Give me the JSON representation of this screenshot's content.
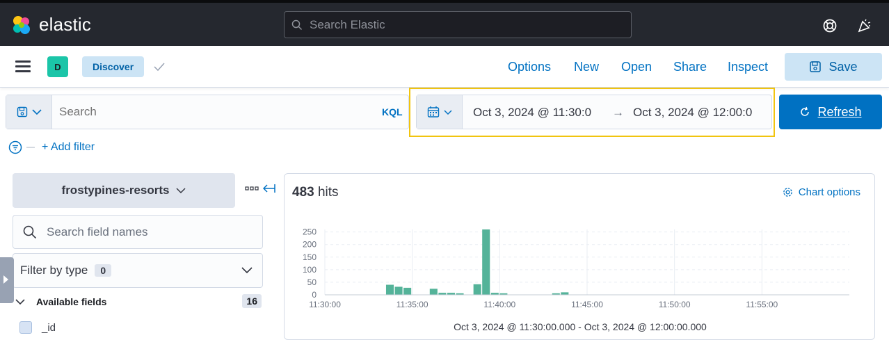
{
  "header": {
    "logo_text": "elastic",
    "search_placeholder": "Search Elastic"
  },
  "subnav": {
    "space_initial": "D",
    "breadcrumb": "Discover",
    "menu": [
      "Options",
      "New",
      "Open",
      "Share",
      "Inspect"
    ],
    "save_label": "Save"
  },
  "query": {
    "placeholder": "Search",
    "language": "KQL"
  },
  "timepicker": {
    "start": "Oct 3, 2024 @ 11:30:0",
    "arrow": "→",
    "end": "Oct 3, 2024 @ 12:00:0",
    "refresh_label": "Refresh"
  },
  "filters": {
    "add_filter": "+ Add filter"
  },
  "sidebar": {
    "index_pattern": "frostypines-resorts",
    "field_search_placeholder": "Search field names",
    "filter_by_type": "Filter by type",
    "filter_count": "0",
    "available_fields": "Available fields",
    "available_count": "16",
    "first_field": "_id"
  },
  "results": {
    "hits_count": "483",
    "hits_word": "hits",
    "chart_options": "Chart options",
    "range_caption": "Oct 3, 2024 @ 11:30:00.000 - Oct 3, 2024 @ 12:00:00.000"
  },
  "colors": {
    "bar": "#54b399",
    "accent": "#0071c2",
    "highlight": "#f1c40f"
  },
  "chart_data": {
    "type": "bar",
    "ylim": [
      0,
      260
    ],
    "yticks": [
      "250",
      "200",
      "150",
      "100",
      "50",
      "0"
    ],
    "ytick_values": [
      250,
      200,
      150,
      100,
      50,
      0
    ],
    "xtick_labels": [
      "11:30:00",
      "11:35:00",
      "11:40:00",
      "11:45:00",
      "11:50:00",
      "11:55:00"
    ],
    "xtick_minutes": [
      0,
      5,
      10,
      15,
      20,
      25
    ],
    "x_minutes": [
      3.5,
      4,
      4.5,
      6,
      6.5,
      7,
      7.5,
      8.5,
      9,
      9.5,
      10,
      13,
      13.5
    ],
    "values": [
      40,
      32,
      28,
      24,
      8,
      8,
      6,
      42,
      260,
      8,
      6,
      6,
      10
    ]
  }
}
